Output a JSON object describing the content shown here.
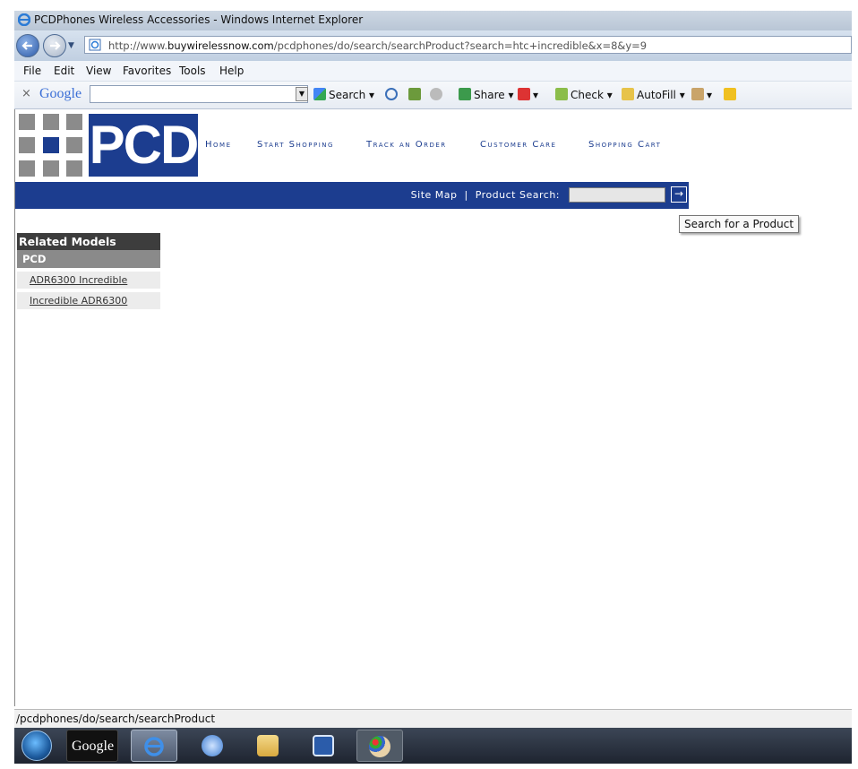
{
  "window": {
    "title": "PCDPhones Wireless Accessories - Windows Internet Explorer",
    "url_prefix": "http://www.",
    "url_domain": "buywirelessnow.com",
    "url_path": "/pcdphones/do/search/searchProduct?search=htc+incredible&x=8&y=9"
  },
  "menu": [
    "File",
    "Edit",
    "View",
    "Favorites",
    "Tools",
    "Help"
  ],
  "google_toolbar": {
    "close": "×",
    "logo": "Google",
    "search_label": "Search",
    "share_label": "Share",
    "check_label": "Check",
    "autofill_label": "AutoFill"
  },
  "site": {
    "logo_text": "PCD",
    "nav": [
      "Home",
      "Start Shopping",
      "Track an Order",
      "Customer Care",
      "Shopping Cart"
    ],
    "site_map": "Site Map",
    "separator": "|",
    "product_search_label": "Product Search:",
    "search_go": "→",
    "tooltip": "Search for a Product"
  },
  "sidebar": {
    "header": "Related Models",
    "group": "PCD",
    "items": [
      "ADR6300 Incredible",
      "Incredible ADR6300"
    ]
  },
  "status": {
    "text": "/pcdphones/do/search/searchProduct"
  },
  "taskbar": {
    "google_label": "Google"
  },
  "colors": {
    "brand_blue": "#1c3d8f",
    "sidebar_header": "#3d3d3d",
    "sidebar_group": "#8a8a8a"
  }
}
